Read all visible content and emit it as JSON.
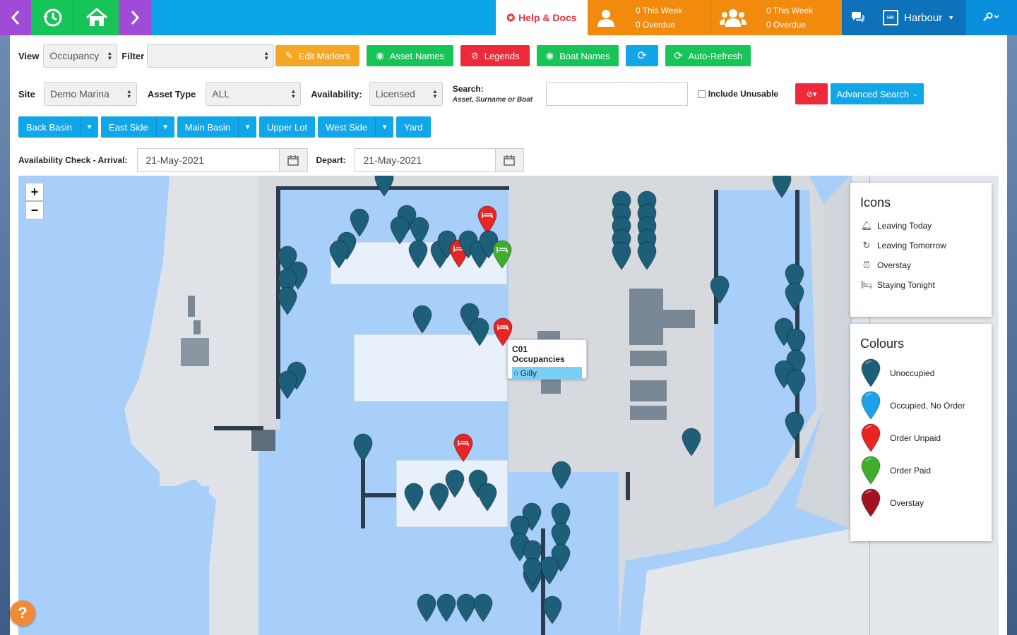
{
  "topbar": {
    "help_label": "Help & Docs",
    "stats": [
      {
        "week": "0 This Week",
        "overdue": "0 Overdue"
      },
      {
        "week": "0 This Week",
        "overdue": "0 Overdue"
      }
    ],
    "site_name": "Harbour",
    "logo_text": "HA"
  },
  "toolbar": {
    "view_label": "View",
    "view_value": "Occupancy",
    "filter_label": "Filter",
    "filter_value": "",
    "edit_markers": "Edit Markers",
    "asset_names": "Asset Names",
    "legends": "Legends",
    "boat_names": "Boat Names",
    "auto_refresh": "Auto-Refresh"
  },
  "filters": {
    "site_label": "Site",
    "site_value": "Demo Marina",
    "asset_type_label": "Asset Type",
    "asset_type_value": "ALL",
    "availability_label": "Availability:",
    "availability_value": "Licensed",
    "search_label": "Search:",
    "search_hint": "Asset, Surname or Boat",
    "search_value": "",
    "include_unusable": "Include Unusable",
    "advanced_search": "Advanced Search"
  },
  "zones": [
    {
      "label": "Back Basin",
      "dropdown": true
    },
    {
      "label": "East Side",
      "dropdown": true
    },
    {
      "label": "Main Basin",
      "dropdown": true
    },
    {
      "label": "Upper Lot",
      "dropdown": false
    },
    {
      "label": "West Side",
      "dropdown": true
    },
    {
      "label": "Yard",
      "dropdown": false
    }
  ],
  "availability": {
    "arrival_label": "Availability Check - Arrival:",
    "arrival_value": "21-May-2021",
    "depart_label": "Depart:",
    "depart_value": "21-May-2021"
  },
  "map": {
    "tooltip_title": "C01 Occupancies",
    "tooltip_entry": "Gilly"
  },
  "legend": {
    "icons_title": "Icons",
    "icons": [
      {
        "label": "Leaving Today",
        "icon": "bell-icon"
      },
      {
        "label": "Leaving Tomorrow",
        "icon": "refresh-icon"
      },
      {
        "label": "Overstay",
        "icon": "alarm-icon"
      },
      {
        "label": "Staying Tonight",
        "icon": "bed-icon"
      }
    ],
    "colours_title": "Colours",
    "colours": [
      {
        "label": "Unoccupied",
        "color": "#1d5f79"
      },
      {
        "label": "Occupied, No Order",
        "color": "#1aa3ec"
      },
      {
        "label": "Order Unpaid",
        "color": "#e82525"
      },
      {
        "label": "Order Paid",
        "color": "#3fae2a"
      },
      {
        "label": "Overstay",
        "color": "#a3121f"
      }
    ]
  }
}
